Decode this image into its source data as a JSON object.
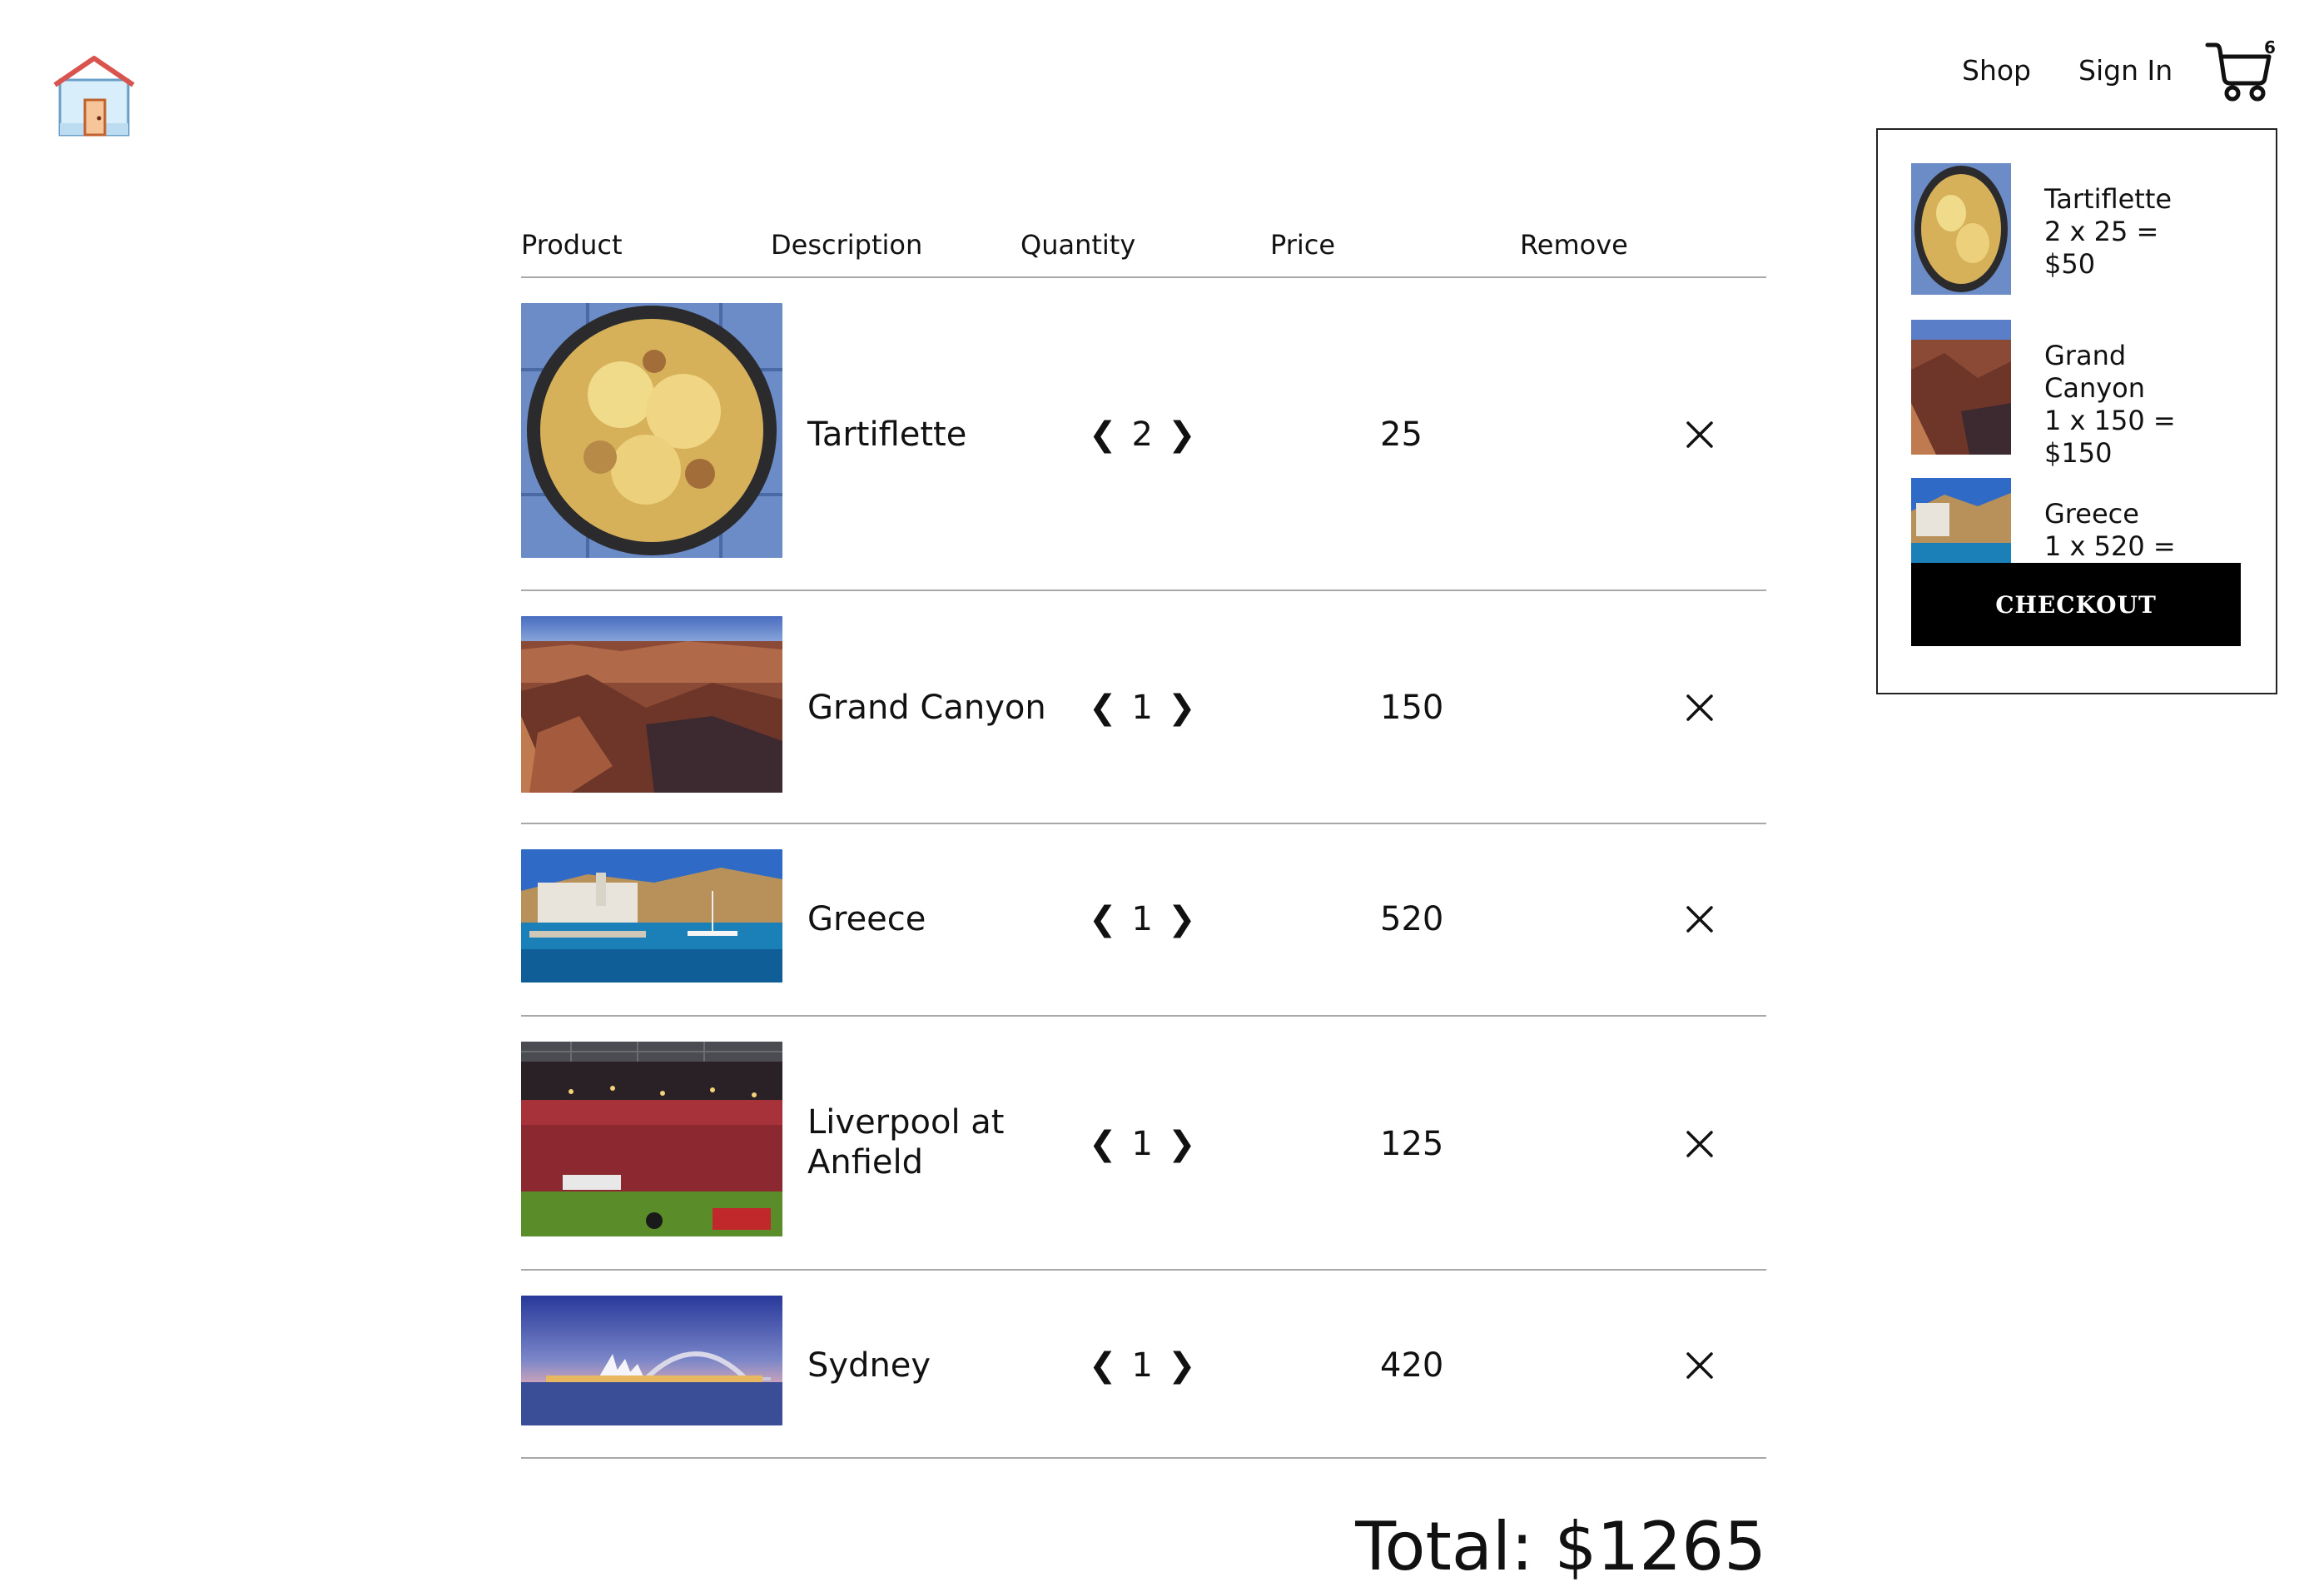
{
  "nav": {
    "shop_label": "Shop",
    "signin_label": "Sign In",
    "cart_count": "6",
    "home_icon": "house-icon",
    "cart_icon": "cart-icon"
  },
  "table": {
    "headers": [
      "Product",
      "Description",
      "Quantity",
      "Price",
      "Remove"
    ],
    "rows": [
      {
        "description": "Tartiflette",
        "quantity": "2",
        "price": "25"
      },
      {
        "description": "Grand Canyon",
        "quantity": "1",
        "price": "150"
      },
      {
        "description": "Greece",
        "quantity": "1",
        "price": "520"
      },
      {
        "description": "Liverpool at Anfield",
        "quantity": "1",
        "price": "125"
      },
      {
        "description": "Sydney",
        "quantity": "1",
        "price": "420"
      }
    ],
    "qty_prev_glyph": "❮",
    "qty_next_glyph": "❯",
    "remove_icon": "close-icon"
  },
  "total_label": "Total: $1265",
  "dropdown": {
    "items": [
      {
        "lines": [
          "Tartiflette",
          "2 x 25 =",
          "$50"
        ]
      },
      {
        "lines": [
          "Grand",
          "Canyon",
          "1 x 150 =",
          "$150"
        ]
      },
      {
        "lines": [
          "Greece",
          "1 x 520 ="
        ]
      }
    ],
    "checkout_label": "CHECKOUT"
  },
  "colors": {
    "header_divider": "#a8a8a8",
    "checkout_bg": "#000000",
    "checkout_text": "#ffffff"
  }
}
